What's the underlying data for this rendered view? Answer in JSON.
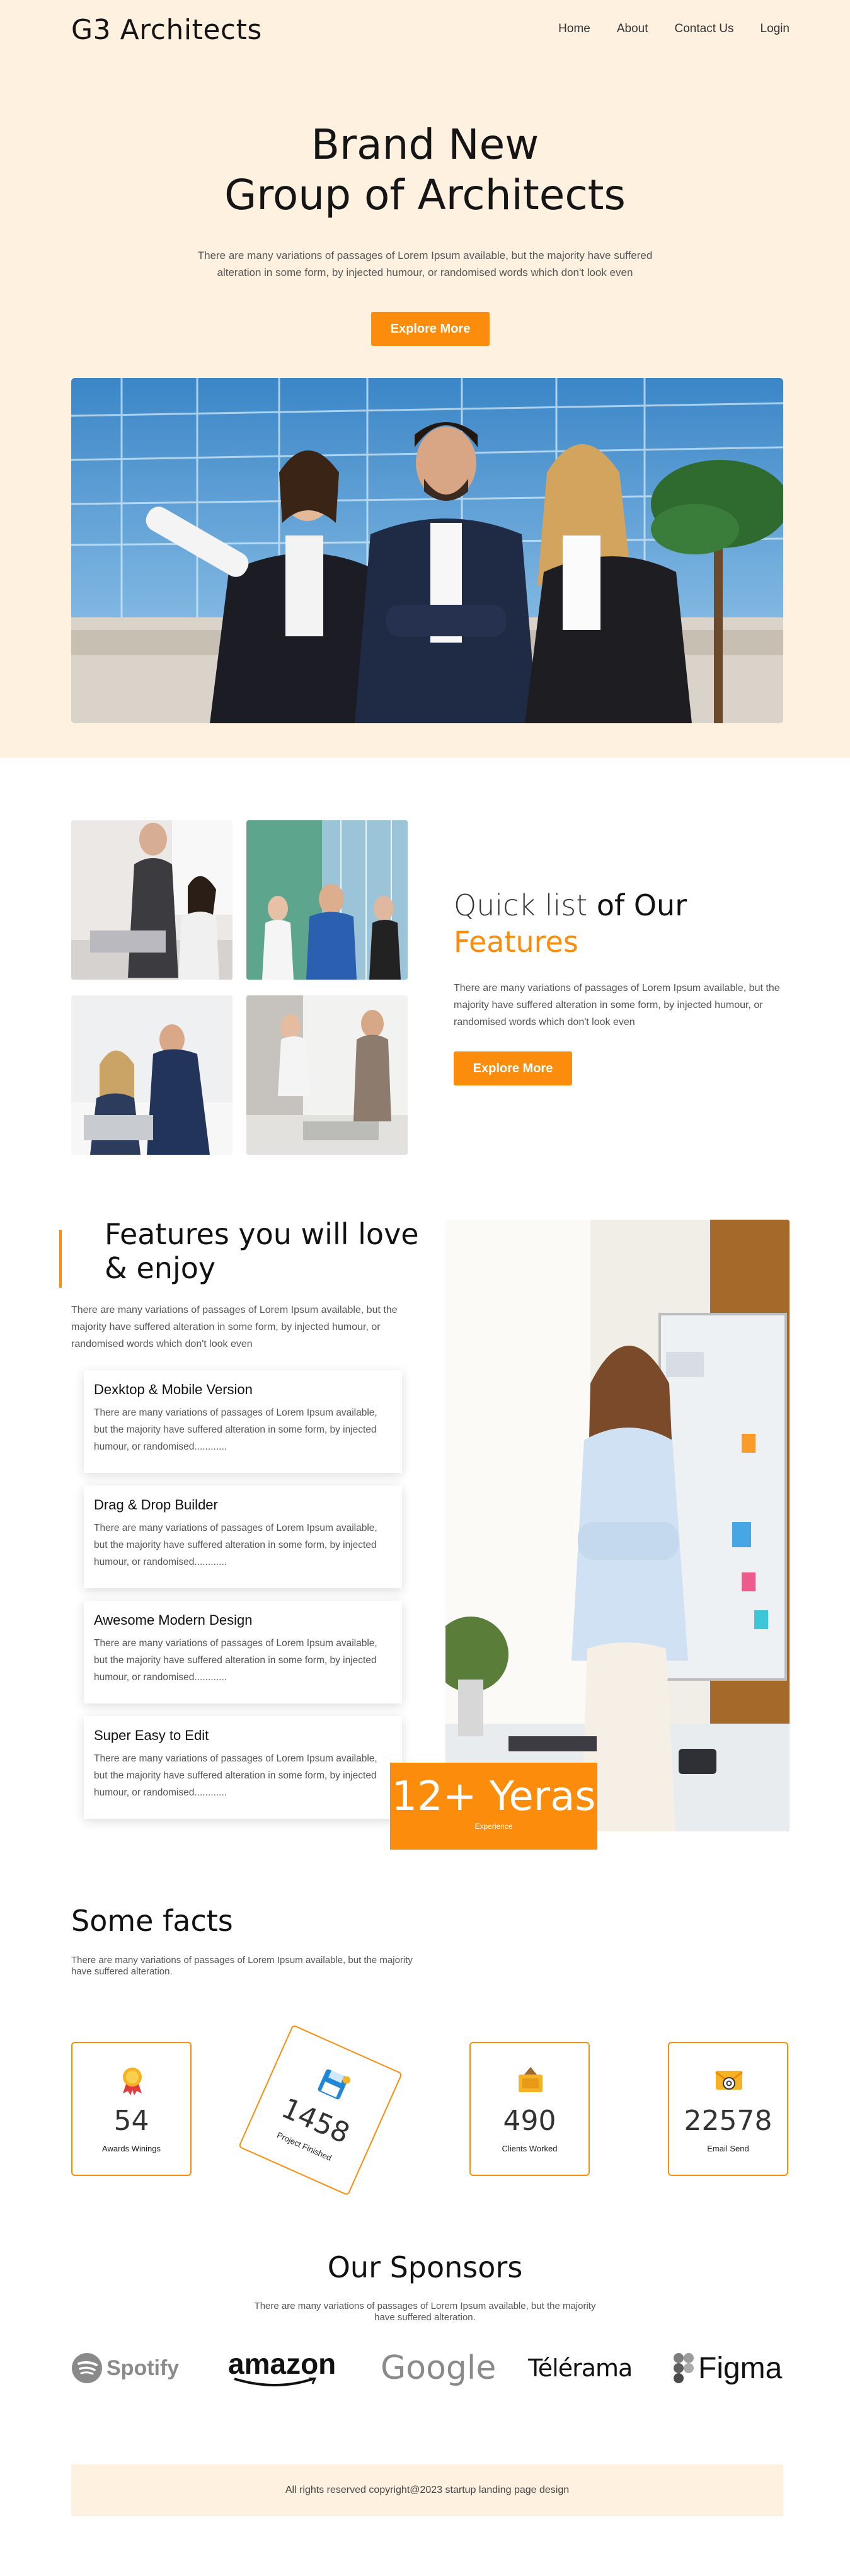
{
  "brand": {
    "logo": "G3 Architects",
    "accent": "#fb8c0c",
    "hero_bg": "#fff1df"
  },
  "nav": {
    "items": [
      "Home",
      "About",
      "Contact Us",
      "Login"
    ]
  },
  "hero": {
    "title_line1": "Brand New",
    "title_line2": "Group of Architects",
    "subtitle": "There are many variations of passages of Lorem Ipsum available, but the majority have suffered alteration in some form, by injected humour, or randomised words which don't look even",
    "button": "Explore More"
  },
  "quick_list": {
    "title_light": "Quick list",
    "title_dark": " of Our",
    "title_orange": "Features",
    "subtitle": "There are many variations of passages of Lorem Ipsum available, but the majority have suffered alteration in some form, by injected humour, or randomised words which don't look even",
    "button": "Explore More"
  },
  "features": {
    "title_line1": "Features you will love",
    "title_line2": "& enjoy",
    "subtitle": "There are many variations of passages of Lorem Ipsum available, but the majority have suffered alteration in some form, by injected humour, or randomised words which don't look even",
    "cards": [
      {
        "title": "Dexktop & Mobile Version",
        "text": "There are many variations of passages of Lorem Ipsum available, but the majority have suffered alteration in some form, by injected humour, or randomised............"
      },
      {
        "title": "Drag & Drop Builder",
        "text": "There are many variations of passages of Lorem Ipsum available, but the majority have suffered alteration in some form, by injected humour, or randomised............"
      },
      {
        "title": "Awesome Modern Design",
        "text": "There are many variations of passages of Lorem Ipsum available, but the majority have suffered alteration in some form, by injected humour, or randomised............"
      },
      {
        "title": "Super Easy to Edit",
        "text": "There are many variations of passages of Lorem Ipsum available, but the majority have suffered alteration in some form, by injected humour, or randomised............"
      }
    ],
    "experience_number": "12+ Yeras",
    "experience_label": "Experience"
  },
  "facts": {
    "title": "Some facts",
    "subtitle": "There are many variations of passages of Lorem Ipsum available, but the majority have suffered alteration.",
    "items": [
      {
        "number": "54",
        "label": "Awards Winings",
        "icon": "award-ribbon-icon"
      },
      {
        "number": "1458",
        "label": "Project Finished",
        "icon": "floppy-disk-icon"
      },
      {
        "number": "490",
        "label": "Clients Worked",
        "icon": "sign-box-icon"
      },
      {
        "number": "22578",
        "label": "Email Send",
        "icon": "email-at-icon"
      }
    ]
  },
  "sponsors": {
    "title": "Our Sponsors",
    "subtitle": "There are many variations of passages of Lorem Ipsum available, but the majority have suffered alteration.",
    "logos": [
      "Spotify",
      "amazon",
      "Google",
      "Télérama",
      "Figma"
    ]
  },
  "footer": {
    "text": "All rights reserved copyright@2023 startup landing page design"
  }
}
